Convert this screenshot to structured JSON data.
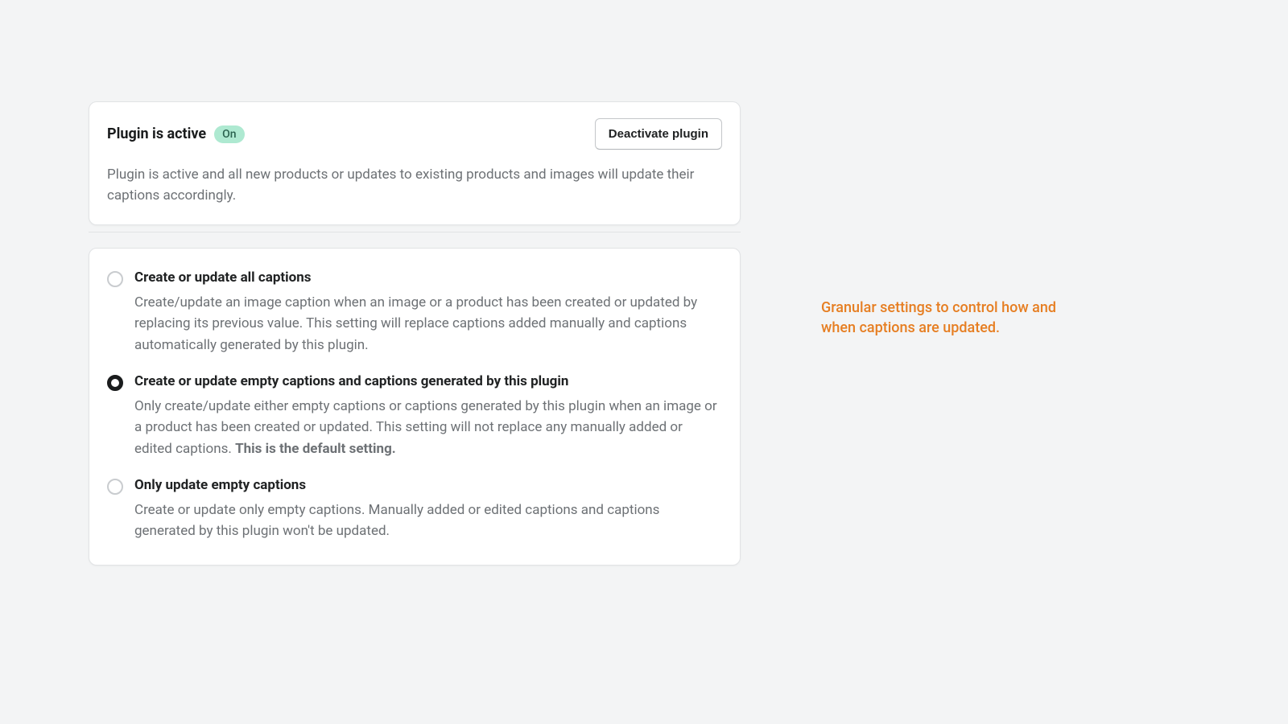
{
  "status": {
    "title": "Plugin is active",
    "badge": "On",
    "button": "Deactivate plugin",
    "description": "Plugin is active and all new products or updates to existing products and images will update their captions accordingly."
  },
  "options": [
    {
      "selected": false,
      "title": "Create or update all captions",
      "desc": "Create/update an image caption when an image or a product has been created or updated by replacing its previous value. This setting will replace captions added manually and captions automatically generated by this plugin."
    },
    {
      "selected": true,
      "title": "Create or update empty captions and captions generated by this plugin",
      "desc_prefix": "Only create/update either empty captions or captions generated by this plugin when an image or a product has been created or updated. This setting will not replace any manually added or edited captions. ",
      "desc_strong": "This is the default setting."
    },
    {
      "selected": false,
      "title": "Only update empty captions",
      "desc": "Create or update only empty captions. Manually added or edited captions and captions generated by this plugin won't be updated."
    }
  ],
  "annotation": "Granular settings to control how and when captions are updated."
}
